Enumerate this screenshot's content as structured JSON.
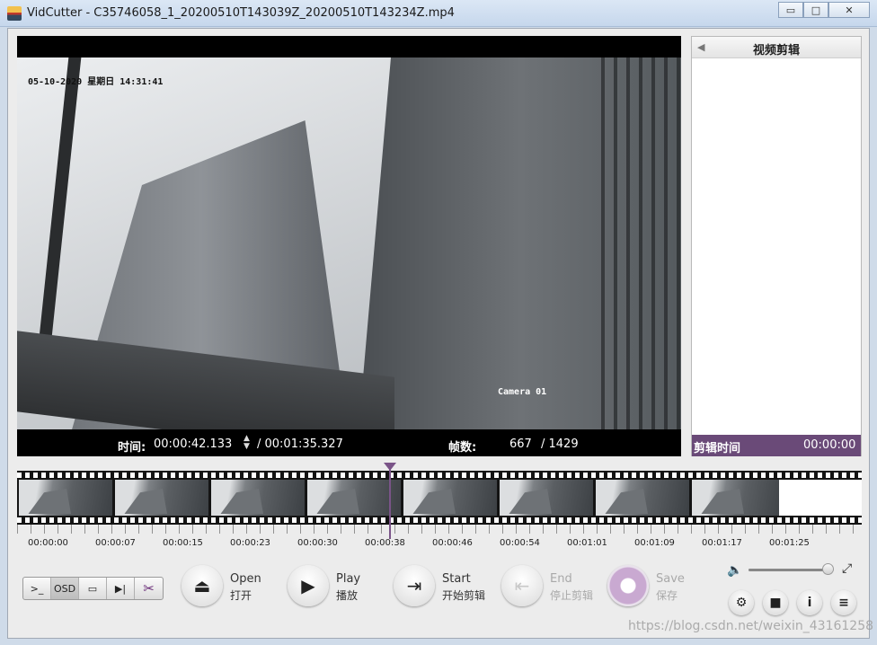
{
  "window": {
    "title": "VidCutter - C35746058_1_20200510T143039Z_20200510T143234Z.mp4",
    "minimize": "▭",
    "maximize": "□",
    "close": "✕"
  },
  "video": {
    "osd_timestamp": "05-10-2020 星期日 14:31:41",
    "osd_camera": "Camera 01",
    "time_label": "时间:",
    "current_time": "00:00:42.133",
    "spin_up": "▲",
    "spin_down": "▼",
    "duration": "/ 00:01:35.327",
    "frames_label": "帧数:",
    "current_frame": "667",
    "total_frames": "/ 1429"
  },
  "clip_panel": {
    "collapse_icon": "◀",
    "title": "视频剪辑",
    "footer_label": "剪辑时间",
    "footer_time": "00:00:00"
  },
  "timeline": {
    "thumbnail_count": 8,
    "tick_labels": [
      "00:00:00",
      "00:00:07",
      "00:00:15",
      "00:00:23",
      "00:00:30",
      "00:00:38",
      "00:00:46",
      "00:00:54",
      "00:01:01",
      "00:01:09",
      "00:01:17",
      "00:01:25"
    ]
  },
  "toolbar": {
    "console_label": ">_",
    "osd_label": "OSD",
    "screenshot_icon": "▭",
    "next_frame_icon": "▶|",
    "cut_icon": "✂"
  },
  "controls": {
    "open": {
      "en": "Open",
      "cn": "打开",
      "icon": "⏏"
    },
    "play": {
      "en": "Play",
      "cn": "播放",
      "icon": "▶"
    },
    "start": {
      "en": "Start",
      "cn": "开始剪辑",
      "icon": "⇥"
    },
    "end": {
      "en": "End",
      "cn": "停止剪辑",
      "icon": "⇤"
    },
    "save": {
      "en": "Save",
      "cn": "保存"
    }
  },
  "volume": {
    "icon": "🔈",
    "level": 0.95,
    "fullscreen_icon": "⤢"
  },
  "bottom_right": {
    "settings_icon": "⚙",
    "camera_icon": "■",
    "info_icon": "i",
    "menu_icon": "≡"
  },
  "watermark": "https://blog.csdn.net/weixin_43161258"
}
